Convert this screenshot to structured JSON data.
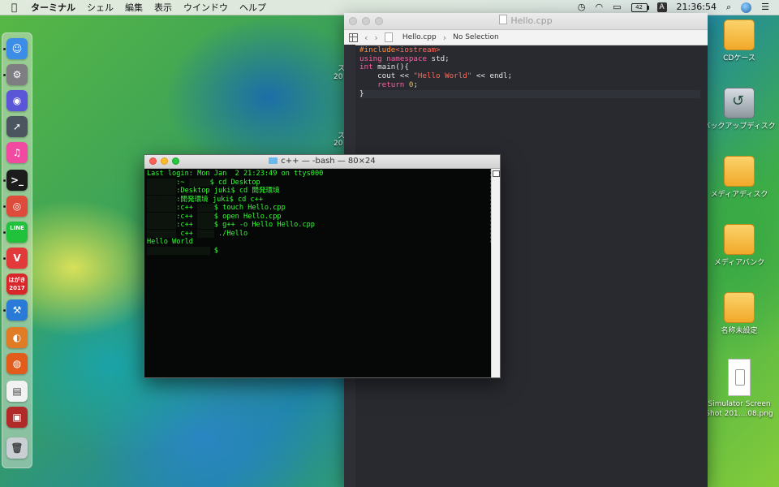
{
  "menubar": {
    "app_name": "ターミナル",
    "menus": [
      "シェル",
      "編集",
      "表示",
      "ウインドウ",
      "ヘルプ"
    ],
    "battery_label": "42",
    "ime_label": "A",
    "clock": "21:36:54"
  },
  "dock": {
    "apps": [
      {
        "name": "finder",
        "label": "☺",
        "color": "#3b8de8"
      },
      {
        "name": "system-preferences",
        "label": "⚙",
        "color": "#7d7d82"
      },
      {
        "name": "siri",
        "label": "◉",
        "color": "#5b56d8"
      },
      {
        "name": "launchpad",
        "label": "➚",
        "color": "#4a5560"
      },
      {
        "name": "itunes",
        "label": "♫",
        "color": "#f24aa0"
      },
      {
        "name": "terminal",
        "label": ">_",
        "color": "#1c1c1c"
      },
      {
        "name": "chrome",
        "label": "◎",
        "color": "#de4b3a"
      },
      {
        "name": "line",
        "label": "LINE",
        "color": "#1fc23a"
      },
      {
        "name": "vivaldi",
        "label": "V",
        "color": "#e23a3a"
      },
      {
        "name": "hagaki",
        "label": "はがき 2017",
        "color": "#d8262b"
      },
      {
        "name": "xcode",
        "label": "⚒",
        "color": "#2a7bd8"
      },
      {
        "name": "blender",
        "label": "◐",
        "color": "#e07b26"
      },
      {
        "name": "firefox",
        "label": "◍",
        "color": "#e25d1c"
      },
      {
        "name": "preview",
        "label": "▤",
        "color": "#f2f2f2"
      },
      {
        "name": "photo-booth",
        "label": "▣",
        "color": "#b12a2a"
      },
      {
        "name": "trash",
        "label": "🗑",
        "color": "#c9cfd3"
      }
    ]
  },
  "desktop": {
    "icons": [
      {
        "type": "drive",
        "label": "CDケース"
      },
      {
        "type": "tm",
        "label": "バックアップディスク"
      },
      {
        "type": "drive",
        "label": "メディアディスク"
      },
      {
        "type": "drive",
        "label": "メディアバンク"
      },
      {
        "type": "drive",
        "label": "名称未設定"
      },
      {
        "type": "png",
        "label": "Simulator Screen Shot 201....08.png"
      }
    ],
    "stray_texts": [
      "20",
      "20",
      "ス",
      "ス"
    ]
  },
  "editor": {
    "title": "Hello.cpp",
    "breadcrumb_file": "Hello.cpp",
    "breadcrumb_selection": "No Selection",
    "code_lines": [
      [
        {
          "t": "#include",
          "c": "pre"
        },
        {
          "t": "<iostream>",
          "c": "str"
        }
      ],
      [
        {
          "t": "using",
          "c": "kw"
        },
        {
          "t": " "
        },
        {
          "t": "namespace",
          "c": "kw"
        },
        {
          "t": " std;"
        }
      ],
      [
        {
          "t": "int",
          "c": "kw"
        },
        {
          "t": " main(){"
        }
      ],
      [
        {
          "t": "    cout << "
        },
        {
          "t": "\"Hello World\"",
          "c": "str"
        },
        {
          "t": " << endl;"
        }
      ],
      [
        {
          "t": "    "
        },
        {
          "t": "return",
          "c": "kw"
        },
        {
          "t": " "
        },
        {
          "t": "0",
          "c": "num"
        },
        {
          "t": ";"
        }
      ],
      [
        {
          "t": "}"
        }
      ]
    ]
  },
  "terminal": {
    "title": "c++ — -bash — 80×24",
    "lines": [
      [
        {
          "t": "Last login: Mon Jan  2 21:23:49 on ttys000"
        }
      ],
      [
        {
          "t": "xxxxxxx",
          "r": true
        },
        {
          "t": ":~ "
        },
        {
          "t": "xxxxx",
          "r": true
        },
        {
          "t": "$ cd Desktop"
        }
      ],
      [
        {
          "t": "xxxxxxx",
          "r": true
        },
        {
          "t": ":Desktop juki$ cd 開発環境"
        }
      ],
      [
        {
          "t": "xxxxxxx",
          "r": true
        },
        {
          "t": ":開発環境 juki$ cd c++"
        }
      ],
      [
        {
          "t": "xxxxxxx",
          "r": true
        },
        {
          "t": ":c++ "
        },
        {
          "t": "xxxx",
          "r": true
        },
        {
          "t": "$ touch Hello.cpp"
        }
      ],
      [
        {
          "t": "xxxxxxx",
          "r": true
        },
        {
          "t": ":c++ "
        },
        {
          "t": "xxxx",
          "r": true
        },
        {
          "t": "$ open Hello.cpp"
        }
      ],
      [
        {
          "t": "xxxxxxx",
          "r": true
        },
        {
          "t": ":c++ "
        },
        {
          "t": "xxxx",
          "r": true
        },
        {
          "t": "$ g++ -o Hello Hello.cpp"
        }
      ],
      [
        {
          "t": "xxxxxxx",
          "r": true
        },
        {
          "t": " c++ "
        },
        {
          "t": "xxxx",
          "r": true
        },
        {
          "t": " ./Hello"
        }
      ],
      [
        {
          "t": "Hello World"
        }
      ],
      [
        {
          "t": "xxxxxxxxxxxxxxx",
          "r": true
        },
        {
          "t": " $"
        }
      ]
    ]
  },
  "colors": {
    "terminal_text": "#33ff33",
    "editor_bg": "#292a30",
    "keyword": "#fc5fa3",
    "string": "#fc6a5d",
    "preprocessor": "#fd8f3f"
  }
}
